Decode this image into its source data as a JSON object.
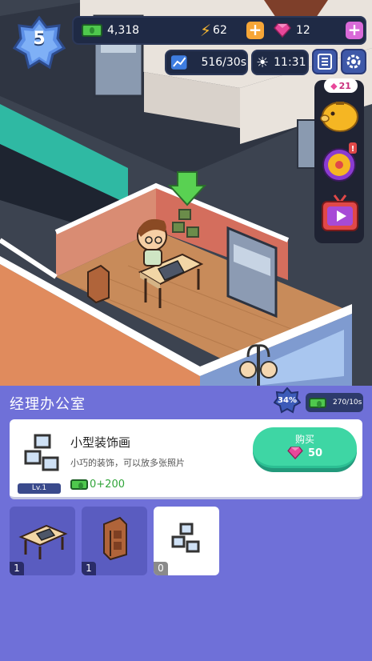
{
  "hud": {
    "level": "5",
    "cash": "4,318",
    "energy": "62",
    "gems": "12",
    "income_rate": "516/30s",
    "time": "11:31",
    "side_gem_reward": "21"
  },
  "panel": {
    "title": "经理办公室",
    "progress_percent": "34%",
    "room_rate": "270/10s"
  },
  "item": {
    "name": "小型装饰画",
    "description": "小巧的装饰，可以放多张照片",
    "level": "Lv.1",
    "bonus_base": "0",
    "bonus_add": "+200",
    "buy_label": "购买",
    "buy_cost": "50"
  },
  "slots": [
    {
      "name": "desk",
      "count": "1"
    },
    {
      "name": "cabinet",
      "count": "1"
    },
    {
      "name": "decor-painting",
      "count": "0"
    }
  ],
  "colors": {
    "panel_bg": "#6f70d8",
    "buy_button": "#3ed6a4",
    "cash_green": "#4fc84d",
    "gem_pink": "#e8479a",
    "plus_orange": "#f7a637"
  }
}
